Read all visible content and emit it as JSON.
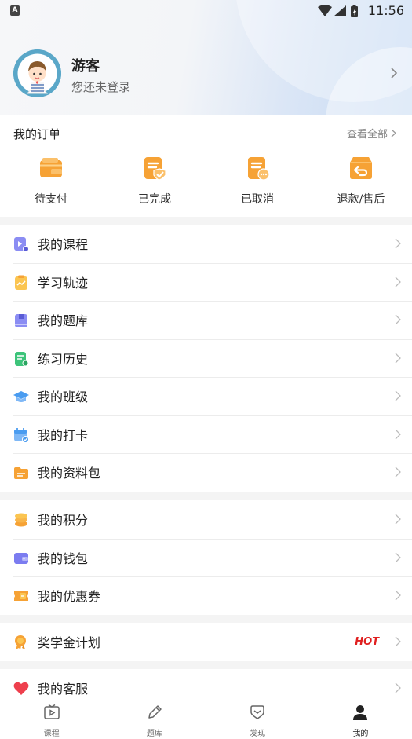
{
  "status_bar": {
    "notification_glyph": "A",
    "time": "11:56",
    "icons": [
      "wifi-icon",
      "signal-icon",
      "battery-icon"
    ]
  },
  "profile": {
    "name": "游客",
    "subtitle": "您还未登录"
  },
  "orders": {
    "title": "我的订单",
    "view_all": "查看全部",
    "items": [
      {
        "label": "待支付",
        "icon": "wallet-icon"
      },
      {
        "label": "已完成",
        "icon": "order-done-icon"
      },
      {
        "label": "已取消",
        "icon": "order-cancel-icon"
      },
      {
        "label": "退款/售后",
        "icon": "refund-icon"
      }
    ]
  },
  "menu": {
    "group1": [
      {
        "label": "我的课程",
        "icon": "course-icon"
      },
      {
        "label": "学习轨迹",
        "icon": "track-icon"
      },
      {
        "label": "我的题库",
        "icon": "question-bank-icon"
      },
      {
        "label": "练习历史",
        "icon": "practice-history-icon"
      },
      {
        "label": "我的班级",
        "icon": "class-icon"
      },
      {
        "label": "我的打卡",
        "icon": "checkin-icon"
      },
      {
        "label": "我的资料包",
        "icon": "folder-icon"
      }
    ],
    "group2": [
      {
        "label": "我的积分",
        "icon": "points-icon"
      },
      {
        "label": "我的钱包",
        "icon": "purse-icon"
      },
      {
        "label": "我的优惠券",
        "icon": "coupon-icon"
      }
    ],
    "group3": [
      {
        "label": "奖学金计划",
        "icon": "scholarship-icon",
        "badge": "HOT"
      }
    ],
    "group4": [
      {
        "label": "我的客服",
        "icon": "heart-icon"
      }
    ]
  },
  "bottom_nav": {
    "tabs": [
      {
        "label": "课程",
        "icon": "play-tv-icon"
      },
      {
        "label": "题库",
        "icon": "pencil-icon"
      },
      {
        "label": "发现",
        "icon": "discover-icon"
      },
      {
        "label": "我的",
        "icon": "user-icon",
        "active": true
      }
    ]
  },
  "colors": {
    "accent_orange": "#f7a035",
    "hot_red": "#e02020",
    "purple": "#7b7cf0",
    "blue": "#4a9cf0",
    "green": "#3dc47a"
  }
}
